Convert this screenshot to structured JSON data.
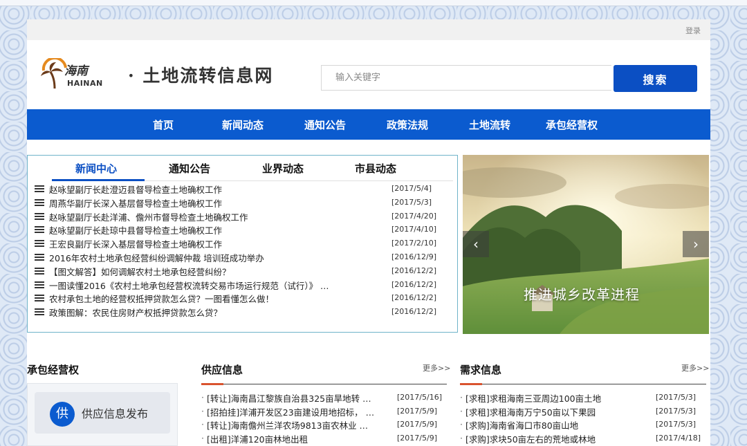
{
  "header": {
    "login": "登录",
    "logo_cn_small": "海南",
    "logo_en": "HAINAN",
    "logo_title": "· 土地流转信息网",
    "search_placeholder": "输入关键字",
    "search_button": "搜索"
  },
  "nav": {
    "items": [
      "首页",
      "新闻动态",
      "通知公告",
      "政策法规",
      "土地流转",
      "承包经营权"
    ]
  },
  "news": {
    "tabs": [
      "新闻中心",
      "通知公告",
      "业界动态",
      "市县动态"
    ],
    "active_tab": 0,
    "items": [
      {
        "title": "赵咏望副厅长赴澄迈县督导检查土地确权工作",
        "date": "[2017/5/4]"
      },
      {
        "title": "周燕华副厅长深入基层督导检查土地确权工作",
        "date": "[2017/5/3]"
      },
      {
        "title": "赵咏望副厅长赴洋浦、儋州市督导检查土地确权工作",
        "date": "[2017/4/20]"
      },
      {
        "title": "赵咏望副厅长赴琼中县督导检查土地确权工作",
        "date": "[2017/4/10]"
      },
      {
        "title": "王宏良副厅长深入基层督导检查土地确权工作",
        "date": "[2017/2/10]"
      },
      {
        "title": "2016年农村土地承包经营纠纷调解仲裁 培训班成功举办",
        "date": "[2016/12/9]"
      },
      {
        "title": "【图文解答】如何调解农村土地承包经营纠纷？",
        "date": "[2016/12/2]"
      },
      {
        "title": "一图读懂2016《农村土地承包经营权流转交易市场运行规范（试行）》 …",
        "date": "[2016/12/2]"
      },
      {
        "title": "农村承包土地的经营权抵押贷款怎么贷？一图看懂怎么做！",
        "date": "[2016/12/2]"
      },
      {
        "title": "政策图解：农民住房财产权抵押贷款怎么贷？",
        "date": "[2016/12/2]"
      }
    ]
  },
  "carousel": {
    "caption": "推进城乡改革进程",
    "prev": "‹",
    "next": "›"
  },
  "contract": {
    "title": "承包经营权",
    "publish_icon": "供",
    "publish_label": "供应信息发布"
  },
  "supply": {
    "title": "供应信息",
    "more": "更多>>",
    "items": [
      {
        "title": "[转让]海南昌江黎族自治县325亩旱地转 …",
        "date": "[2017/5/16]"
      },
      {
        "title": "[招拍挂]洋浦开发区23亩建设用地招标， …",
        "date": "[2017/5/9]"
      },
      {
        "title": "[转让]海南儋州兰洋农场9813亩农林业 …",
        "date": "[2017/5/9]"
      },
      {
        "title": "[出租]洋浦120亩林地出租",
        "date": "[2017/5/9]"
      }
    ]
  },
  "demand": {
    "title": "需求信息",
    "more": "更多>>",
    "items": [
      {
        "title": "[求租]求租海南三亚周边100亩土地",
        "date": "[2017/5/3]"
      },
      {
        "title": "[求租]求租海南万宁50亩以下果园",
        "date": "[2017/5/3]"
      },
      {
        "title": "[求购]海南省海口市80亩山地",
        "date": "[2017/5/3]"
      },
      {
        "title": "[求购]求块50亩左右的荒地或林地",
        "date": "[2017/4/18]"
      }
    ]
  }
}
